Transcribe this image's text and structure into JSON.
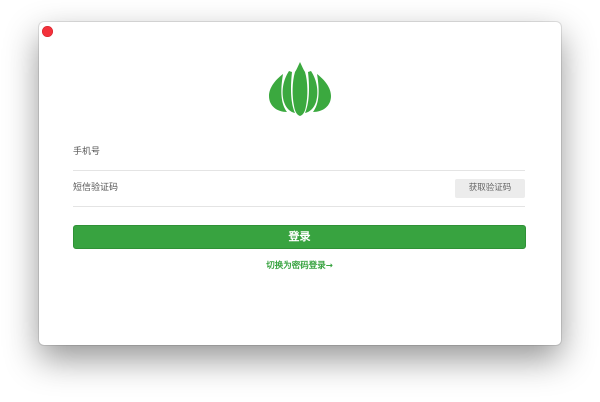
{
  "window": {
    "close_button": "close"
  },
  "logo": {
    "icon": "garlic-logo-icon",
    "color": "#3ba93f"
  },
  "form": {
    "phone_placeholder": "手机号",
    "phone_value": "",
    "code_placeholder": "短信验证码",
    "code_value": "",
    "get_code_label": "获取验证码",
    "login_label": "登录",
    "switch_label": "切换为密码登录→"
  },
  "colors": {
    "accent": "#38a340",
    "close": "#f3313b",
    "button_secondary_bg": "#ececec"
  }
}
